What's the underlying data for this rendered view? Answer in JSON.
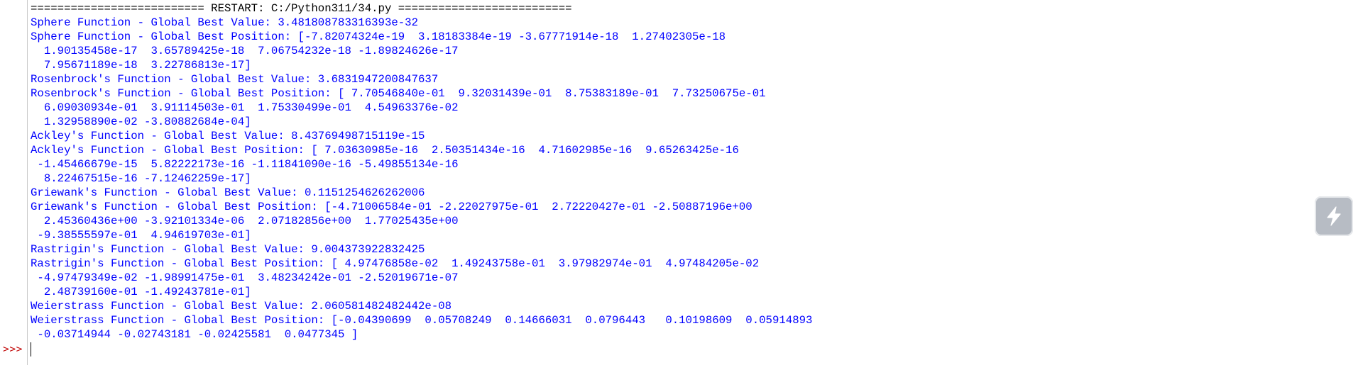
{
  "shell": {
    "prompt": ">>>",
    "output_lines": [
      {
        "kind": "restart",
        "text": "========================== RESTART: C:/Python311/34.py =========================="
      },
      {
        "kind": "stdout",
        "text": "Sphere Function - Global Best Value: 3.481808783316393e-32"
      },
      {
        "kind": "stdout",
        "text": "Sphere Function - Global Best Position: [-7.82074324e-19  3.18183384e-19 -3.67771914e-18  1.27402305e-18"
      },
      {
        "kind": "stdout",
        "text": "  1.90135458e-17  3.65789425e-18  7.06754232e-18 -1.89824626e-17"
      },
      {
        "kind": "stdout",
        "text": "  7.95671189e-18  3.22786813e-17]"
      },
      {
        "kind": "stdout",
        "text": "Rosenbrock's Function - Global Best Value: 3.6831947200847637"
      },
      {
        "kind": "stdout",
        "text": "Rosenbrock's Function - Global Best Position: [ 7.70546840e-01  9.32031439e-01  8.75383189e-01  7.73250675e-01"
      },
      {
        "kind": "stdout",
        "text": "  6.09030934e-01  3.91114503e-01  1.75330499e-01  4.54963376e-02"
      },
      {
        "kind": "stdout",
        "text": "  1.32958890e-02 -3.80882684e-04]"
      },
      {
        "kind": "stdout",
        "text": "Ackley's Function - Global Best Value: 8.43769498715119e-15"
      },
      {
        "kind": "stdout",
        "text": "Ackley's Function - Global Best Position: [ 7.03630985e-16  2.50351434e-16  4.71602985e-16  9.65263425e-16"
      },
      {
        "kind": "stdout",
        "text": " -1.45466679e-15  5.82222173e-16 -1.11841090e-16 -5.49855134e-16"
      },
      {
        "kind": "stdout",
        "text": "  8.22467515e-16 -7.12462259e-17]"
      },
      {
        "kind": "stdout",
        "text": "Griewank's Function - Global Best Value: 0.1151254626262006"
      },
      {
        "kind": "stdout",
        "text": "Griewank's Function - Global Best Position: [-4.71006584e-01 -2.22027975e-01  2.72220427e-01 -2.50887196e+00"
      },
      {
        "kind": "stdout",
        "text": "  2.45360436e+00 -3.92101334e-06  2.07182856e+00  1.77025435e+00"
      },
      {
        "kind": "stdout",
        "text": " -9.38555597e-01  4.94619703e-01]"
      },
      {
        "kind": "stdout",
        "text": "Rastrigin's Function - Global Best Value: 9.004373922832425"
      },
      {
        "kind": "stdout",
        "text": "Rastrigin's Function - Global Best Position: [ 4.97476858e-02  1.49243758e-01  3.97982974e-01  4.97484205e-02"
      },
      {
        "kind": "stdout",
        "text": " -4.97479349e-02 -1.98991475e-01  3.48234242e-01 -2.52019671e-07"
      },
      {
        "kind": "stdout",
        "text": "  2.48739160e-01 -1.49243781e-01]"
      },
      {
        "kind": "stdout",
        "text": "Weierstrass Function - Global Best Value: 2.060581482482442e-08"
      },
      {
        "kind": "stdout",
        "text": "Weierstrass Function - Global Best Position: [-0.04390699  0.05708249  0.14666031  0.0796443   0.10198609  0.05914893"
      },
      {
        "kind": "stdout",
        "text": " -0.03714944 -0.02743181 -0.02425581  0.0477345 ]"
      }
    ],
    "input_value": ""
  },
  "floating_button": {
    "icon": "lightning-bolt-icon"
  },
  "colors": {
    "stdout": "#0000ff",
    "restart": "#000000",
    "prompt": "#c00000",
    "background": "#ffffff",
    "gutter_border": "#c8c8c8",
    "floating_button": "#b7bcc4"
  }
}
